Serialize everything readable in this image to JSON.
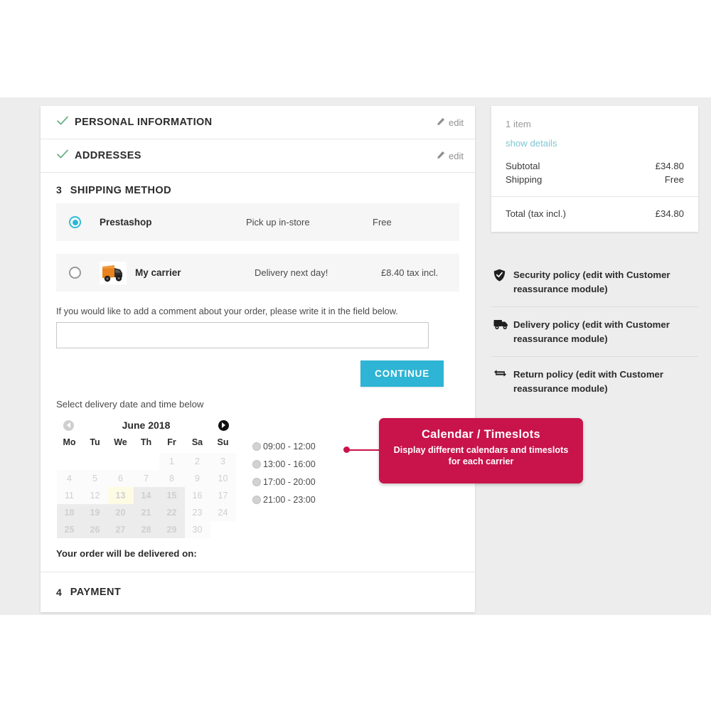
{
  "checkout": {
    "steps": [
      {
        "title": "PERSONAL INFORMATION",
        "state": "done",
        "edit_label": "edit"
      },
      {
        "title": "ADDRESSES",
        "state": "done",
        "edit_label": "edit"
      }
    ],
    "shipping": {
      "number": "3",
      "title": "SHIPPING METHOD",
      "options": [
        {
          "name": "Prestashop",
          "delay": "Pick up in-store",
          "price": "Free",
          "selected": true,
          "has_logo": false
        },
        {
          "name": "My carrier",
          "delay": "Delivery next day!",
          "price": "£8.40 tax incl.",
          "selected": false,
          "has_logo": true
        }
      ],
      "comment_label": "If you would like to add a comment about your order, please write it in the field below.",
      "comment_value": "",
      "comment_placeholder": "",
      "continue_label": "CONTINUE"
    },
    "calendar_block": {
      "intro": "Select delivery date and time below",
      "month_label": "June 2018",
      "prev_label": "◀",
      "next_label": "▶",
      "weekdays": [
        "Mo",
        "Tu",
        "We",
        "Th",
        "Fr",
        "Sa",
        "Su"
      ],
      "weeks": [
        [
          {
            "d": "",
            "t": "empty"
          },
          {
            "d": "",
            "t": "empty"
          },
          {
            "d": "",
            "t": "empty"
          },
          {
            "d": "",
            "t": "empty"
          },
          {
            "d": "1",
            "t": "off"
          },
          {
            "d": "2",
            "t": "off"
          },
          {
            "d": "3",
            "t": "off"
          }
        ],
        [
          {
            "d": "4",
            "t": "off"
          },
          {
            "d": "5",
            "t": "off"
          },
          {
            "d": "6",
            "t": "off"
          },
          {
            "d": "7",
            "t": "off"
          },
          {
            "d": "8",
            "t": "off"
          },
          {
            "d": "9",
            "t": "off"
          },
          {
            "d": "10",
            "t": "off"
          }
        ],
        [
          {
            "d": "11",
            "t": "off"
          },
          {
            "d": "12",
            "t": "off"
          },
          {
            "d": "13",
            "t": "today"
          },
          {
            "d": "14",
            "t": "avail"
          },
          {
            "d": "15",
            "t": "avail"
          },
          {
            "d": "16",
            "t": "off"
          },
          {
            "d": "17",
            "t": "off"
          }
        ],
        [
          {
            "d": "18",
            "t": "avail"
          },
          {
            "d": "19",
            "t": "avail"
          },
          {
            "d": "20",
            "t": "avail"
          },
          {
            "d": "21",
            "t": "avail"
          },
          {
            "d": "22",
            "t": "avail"
          },
          {
            "d": "23",
            "t": "off"
          },
          {
            "d": "24",
            "t": "off"
          }
        ],
        [
          {
            "d": "25",
            "t": "avail"
          },
          {
            "d": "26",
            "t": "avail"
          },
          {
            "d": "27",
            "t": "avail"
          },
          {
            "d": "28",
            "t": "avail"
          },
          {
            "d": "29",
            "t": "avail"
          },
          {
            "d": "30",
            "t": "off"
          },
          {
            "d": "",
            "t": "empty"
          }
        ]
      ],
      "timeslots": [
        {
          "label": "09:00 - 12:00",
          "selected": false
        },
        {
          "label": "13:00 - 16:00",
          "selected": false
        },
        {
          "label": "17:00 - 20:00",
          "selected": false
        },
        {
          "label": "21:00 - 23:00",
          "selected": false
        }
      ],
      "delivered_on_label": "Your order will be delivered on:",
      "delivered_on_value": ""
    },
    "payment": {
      "number": "4",
      "title": "PAYMENT"
    }
  },
  "sidebar": {
    "cart": {
      "item_count": "1 item",
      "show_details": "show details",
      "lines": [
        {
          "label": "Subtotal",
          "value": "£34.80"
        },
        {
          "label": "Shipping",
          "value": "Free"
        }
      ],
      "total_label": "Total (tax incl.)",
      "total_value": "£34.80"
    },
    "policies": [
      {
        "icon": "shield-check-icon",
        "text": "Security policy (edit with Customer reassurance module)"
      },
      {
        "icon": "truck-icon",
        "text": "Delivery policy (edit with Customer reassurance module)"
      },
      {
        "icon": "exchange-arrows-icon",
        "text": "Return policy (edit with Customer reassurance module)"
      }
    ]
  },
  "callout": {
    "title": "Calendar / Timeslots",
    "subtitle": "Display different calendars and timeslots for each carrier",
    "color": "#c8134b"
  },
  "colors": {
    "accent_blue": "#2eb4d4",
    "link_teal": "#7fc7d4",
    "check_green": "#6ab187",
    "callout_crimson": "#c8134b",
    "page_bg": "#ededed"
  }
}
